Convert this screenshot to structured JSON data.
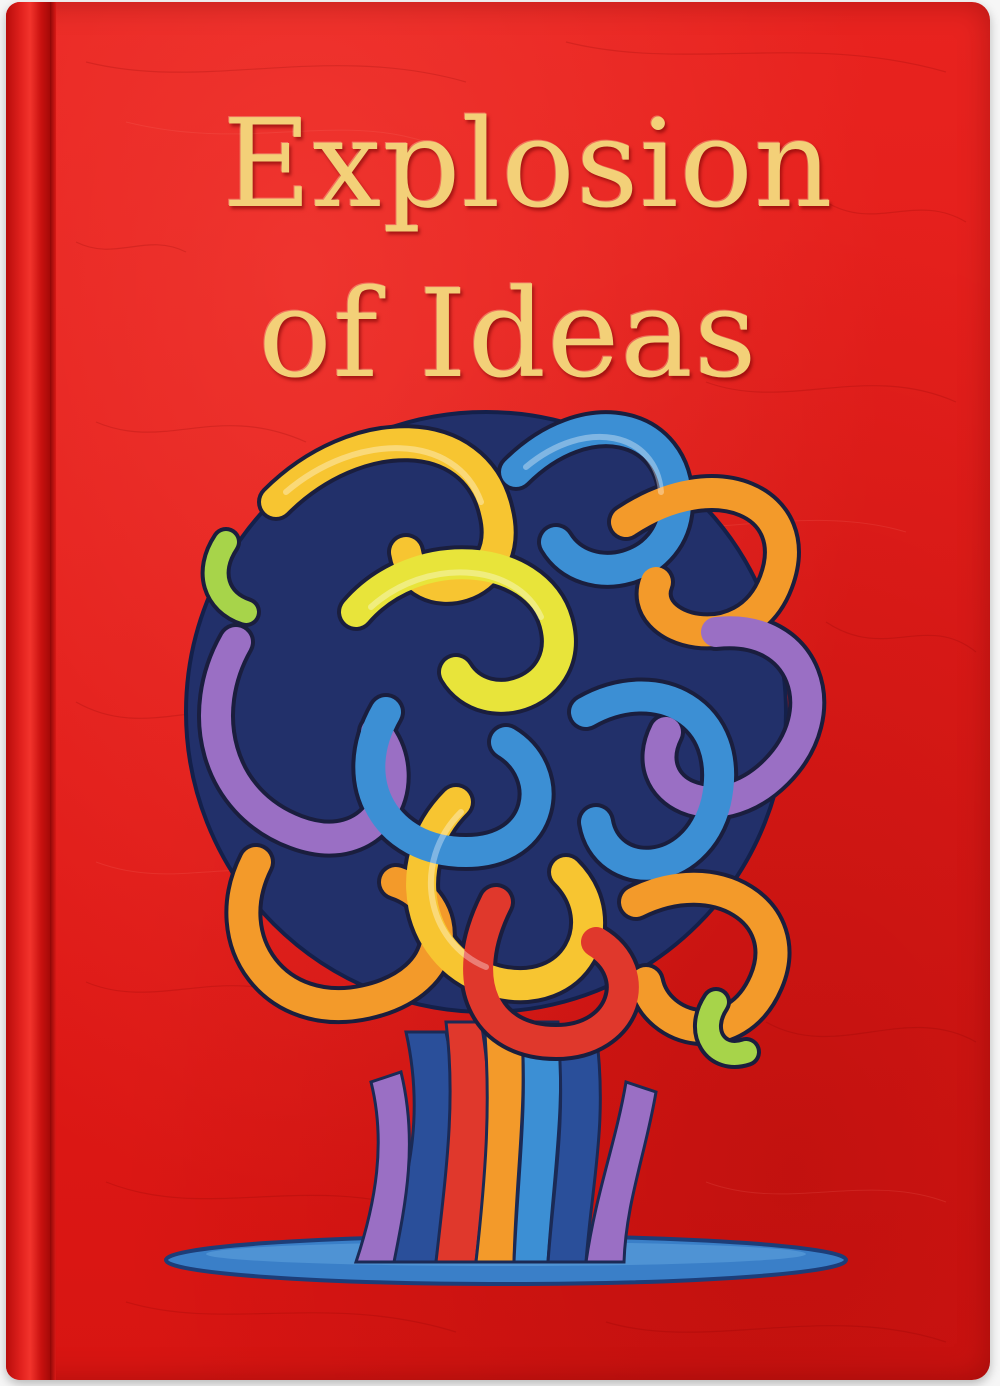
{
  "cover": {
    "title_line1": "Explosion",
    "title_line2": "of Ideas"
  },
  "colors": {
    "cover_red": "#e11b18",
    "title_gold": "#f3d078",
    "ribbon_yellow": "#f7c531",
    "ribbon_blue": "#3c8fd4",
    "ribbon_navy": "#2a4f9a",
    "ribbon_purple": "#9a6fc4",
    "ribbon_orange": "#f39a2a",
    "ribbon_green": "#a7d44a",
    "puddle_blue": "#3a7fc8"
  },
  "illustration": {
    "subject": "tangled-ribbon-tree"
  }
}
